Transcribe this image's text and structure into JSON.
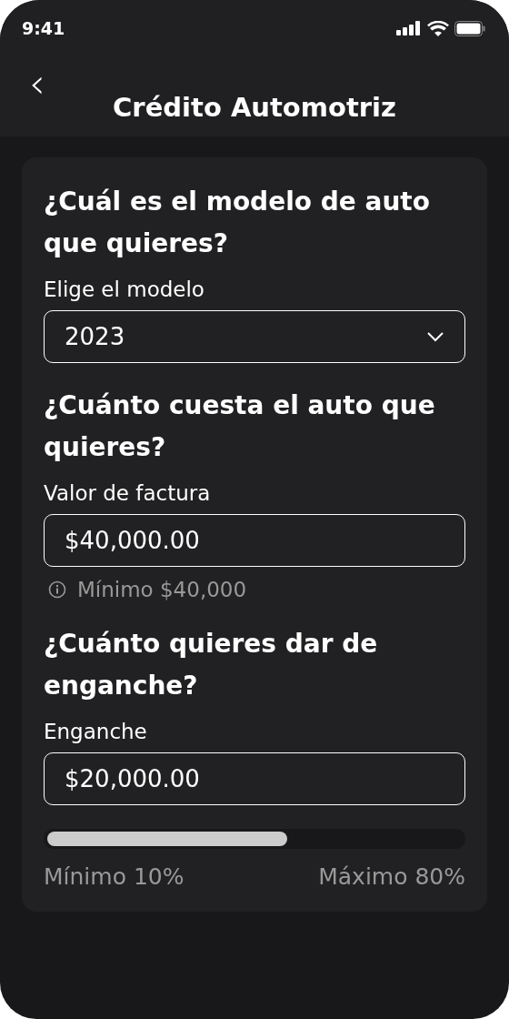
{
  "status_bar": {
    "time": "9:41"
  },
  "header": {
    "back": "‹",
    "title": "Crédito Automotriz"
  },
  "sections": [
    {
      "kind": "select",
      "question": "¿Cuál es el modelo de auto que quieres?",
      "label": "Elige el modelo",
      "value": "2023"
    },
    {
      "kind": "input",
      "question": "¿Cuánto cuesta el auto que quieres?",
      "label": "Valor de factura",
      "value": "$40,000.00",
      "hint": "Mínimo $40,000"
    },
    {
      "kind": "slider",
      "question": "¿Cuánto quieres dar de enganche?",
      "label": "Enganche",
      "value": "$20,000.00",
      "level": 0.58,
      "min_label": "Mínimo 10%",
      "max_label": "Máximo 80%"
    }
  ]
}
